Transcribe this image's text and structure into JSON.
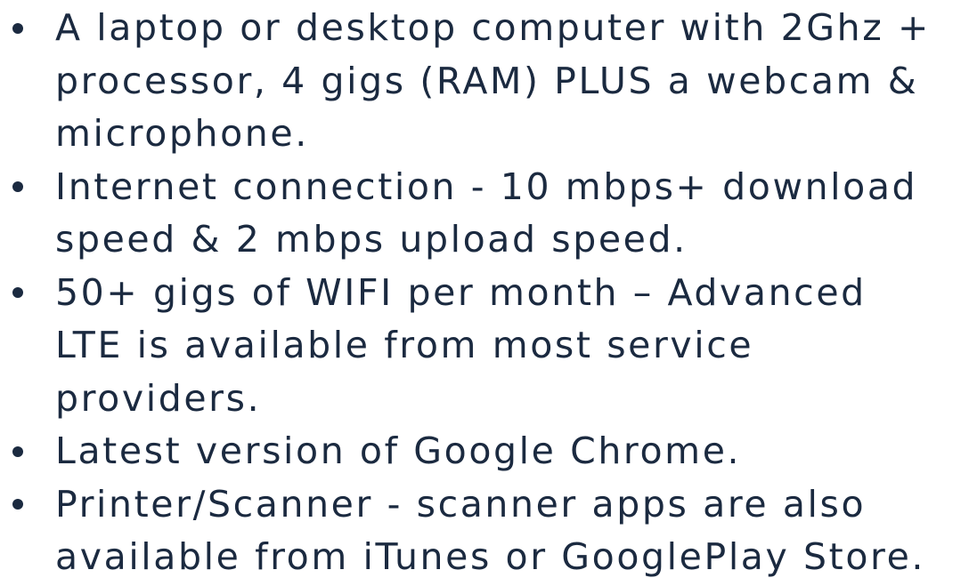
{
  "requirements": [
    {
      "lines": [
        "A laptop or desktop computer with 2Ghz +",
        "processor, 4 gigs (RAM) PLUS a webcam &",
        "microphone."
      ]
    },
    {
      "lines": [
        "Internet connection - 10 mbps+ download",
        "speed & 2 mbps upload speed."
      ]
    },
    {
      "lines": [
        "50+ gigs of WIFI per month – Advanced",
        "LTE is available from most service",
        "providers."
      ]
    },
    {
      "lines": [
        "Latest version of Google Chrome."
      ]
    },
    {
      "lines": [
        "Printer/Scanner - scanner apps are also",
        "available from iTunes or GooglePlay Store."
      ]
    }
  ]
}
